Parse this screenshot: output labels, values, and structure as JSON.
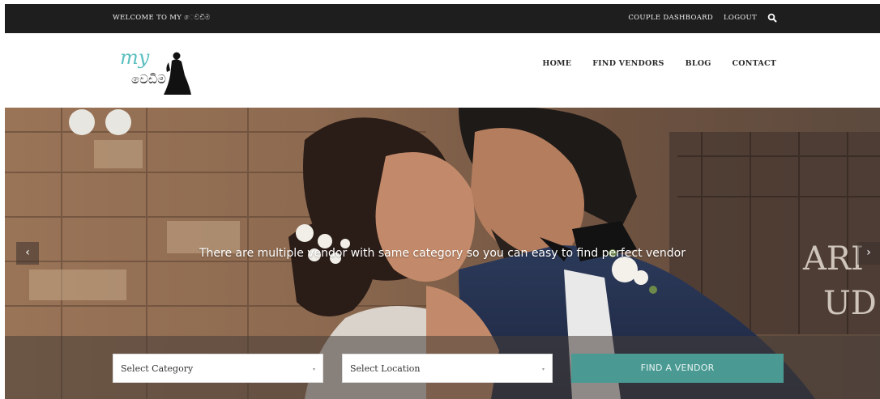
{
  "topbar": {
    "welcome": "WELCOME TO MY ෙවඩිම",
    "links": [
      "COUPLE DASHBOARD",
      "LOGOUT"
    ]
  },
  "header": {
    "logo_text_top": "my",
    "logo_text_bottom": "වෙඩිම",
    "nav": [
      "HOME",
      "FIND VENDORS",
      "BLOG",
      "CONTACT"
    ]
  },
  "hero": {
    "caption": "There are multiple vendor with same category so you can easy to find perfect vendor",
    "prev_glyph": "‹",
    "next_glyph": "›"
  },
  "search": {
    "category_value": "Select Category",
    "location_value": "Select Location",
    "caret": "▾",
    "button_label": "FIND A VENDOR"
  },
  "colors": {
    "topbar_bg": "#1e1e1e",
    "accent_teal": "#4a9a93",
    "logo_teal": "#5bbfbf"
  }
}
